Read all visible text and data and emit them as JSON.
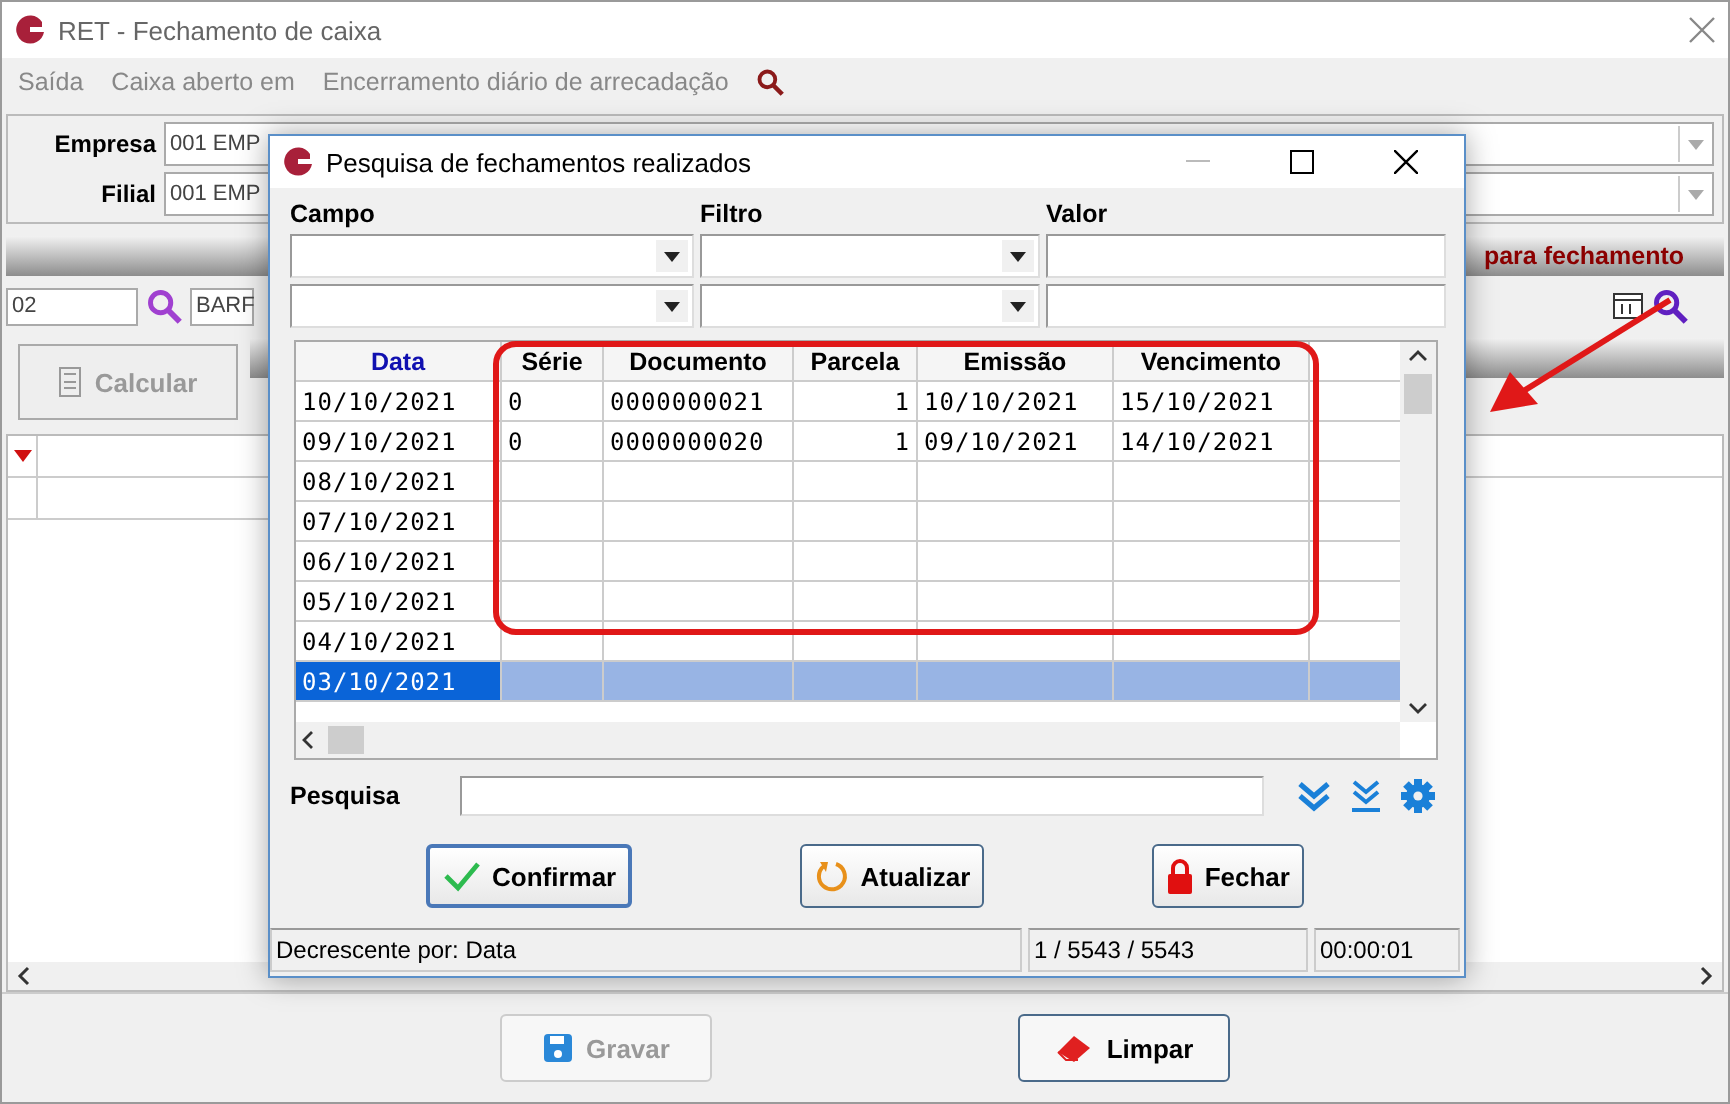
{
  "window": {
    "title": "RET - Fechamento de caixa",
    "menu": [
      "Saída",
      "Caixa aberto em",
      "Encerramento diário de arrecadação"
    ]
  },
  "form": {
    "fields": [
      {
        "label": "Empresa",
        "value": "001 EMP"
      },
      {
        "label": "Filial",
        "value": "001 EMP"
      }
    ],
    "section_title": "para fechamento",
    "code": "02",
    "name": "BARF"
  },
  "calc_button": {
    "label": "Calcular",
    "disabled": true
  },
  "bottom_buttons": [
    {
      "label": "Gravar",
      "disabled": true
    },
    {
      "label": "Limpar",
      "disabled": false
    }
  ],
  "dialog": {
    "title": "Pesquisa de fechamentos realizados",
    "filter_labels": [
      "Campo",
      "Filtro",
      "Valor"
    ],
    "columns": [
      {
        "label": "Data",
        "sorted": true
      },
      {
        "label": "Série",
        "sorted": false
      },
      {
        "label": "Documento",
        "sorted": false
      },
      {
        "label": "Parcela",
        "sorted": false
      },
      {
        "label": "Emissão",
        "sorted": false
      },
      {
        "label": "Vencimento",
        "sorted": false
      }
    ],
    "rows": [
      {
        "cells": [
          "10/10/2021",
          "0",
          "0000000021",
          "1",
          "10/10/2021",
          "15/10/2021"
        ],
        "selected": false
      },
      {
        "cells": [
          "09/10/2021",
          "0",
          "0000000020",
          "1",
          "09/10/2021",
          "14/10/2021"
        ],
        "selected": false
      },
      {
        "cells": [
          "08/10/2021"
        ],
        "selected": false
      },
      {
        "cells": [
          "07/10/2021"
        ],
        "selected": false
      },
      {
        "cells": [
          "06/10/2021"
        ],
        "selected": false
      },
      {
        "cells": [
          "05/10/2021"
        ],
        "selected": false
      },
      {
        "cells": [
          "04/10/2021"
        ],
        "selected": false
      },
      {
        "cells": [
          "03/10/2021"
        ],
        "selected": true
      }
    ],
    "search_label": "Pesquisa",
    "buttons": [
      {
        "label": "Confirmar",
        "kind": "confirm"
      },
      {
        "label": "Atualizar",
        "kind": "refresh"
      },
      {
        "label": "Fechar",
        "kind": "close"
      }
    ],
    "status": [
      "Decrescente por: Data",
      "1 / 5543 / 5543",
      "00:00:01"
    ]
  }
}
